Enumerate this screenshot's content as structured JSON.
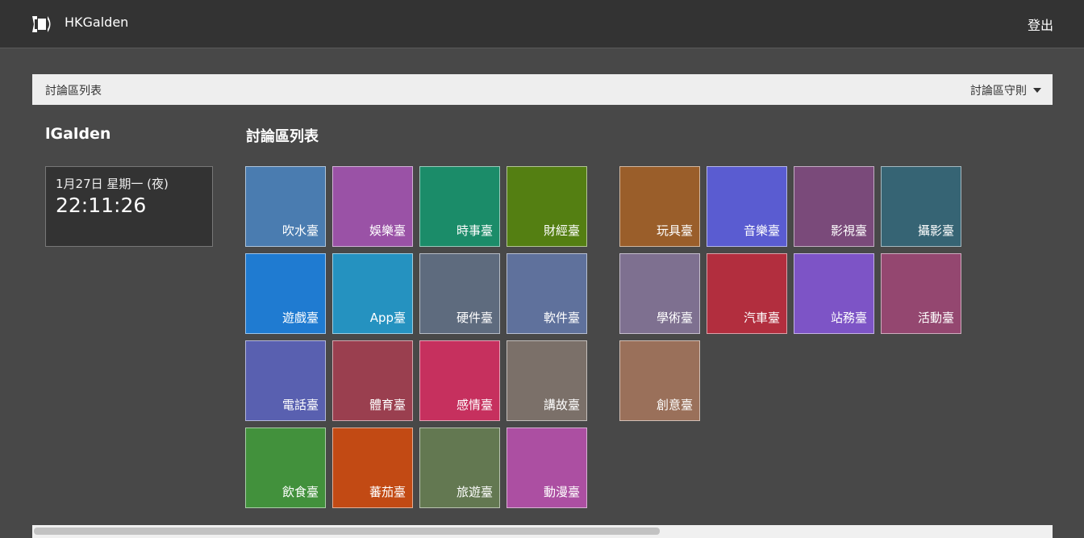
{
  "header": {
    "brand": "HKGalden",
    "logout_label": "登出"
  },
  "subbar": {
    "title": "討論區列表",
    "rules_label": "討論區守則"
  },
  "sidebar": {
    "title": "lGalden",
    "date": "1月27日 星期一 (夜)",
    "time": "22:11:26"
  },
  "main": {
    "title": "討論區列表"
  },
  "boards_left": [
    {
      "label": "吹水臺",
      "color": "#4a7cb0"
    },
    {
      "label": "娛樂臺",
      "color": "#9a52a6"
    },
    {
      "label": "時事臺",
      "color": "#1b8c69"
    },
    {
      "label": "財經臺",
      "color": "#547f12"
    },
    {
      "label": "遊戲臺",
      "color": "#1f7bd1"
    },
    {
      "label": "App臺",
      "color": "#2592c0"
    },
    {
      "label": "硬件臺",
      "color": "#5e6b7e"
    },
    {
      "label": "軟件臺",
      "color": "#5f719c"
    },
    {
      "label": "電話臺",
      "color": "#5960b0"
    },
    {
      "label": "體育臺",
      "color": "#9a3f4f"
    },
    {
      "label": "感情臺",
      "color": "#c6305e"
    },
    {
      "label": "講故臺",
      "color": "#7b7069"
    },
    {
      "label": "飲食臺",
      "color": "#42913c"
    },
    {
      "label": "蕃茄臺",
      "color": "#c24a14"
    },
    {
      "label": "旅遊臺",
      "color": "#637851"
    },
    {
      "label": "動漫臺",
      "color": "#ac4fa2"
    }
  ],
  "boards_right": [
    {
      "label": "玩具臺",
      "color": "#9a5e2a"
    },
    {
      "label": "音樂臺",
      "color": "#5a5cd1"
    },
    {
      "label": "影視臺",
      "color": "#7a4a7a"
    },
    {
      "label": "攝影臺",
      "color": "#366474"
    },
    {
      "label": "學術臺",
      "color": "#7e7090"
    },
    {
      "label": "汽車臺",
      "color": "#b22e3e"
    },
    {
      "label": "站務臺",
      "color": "#7d54c6"
    },
    {
      "label": "活動臺",
      "color": "#944770"
    },
    {
      "label": "創意臺",
      "color": "#9a705a"
    }
  ]
}
